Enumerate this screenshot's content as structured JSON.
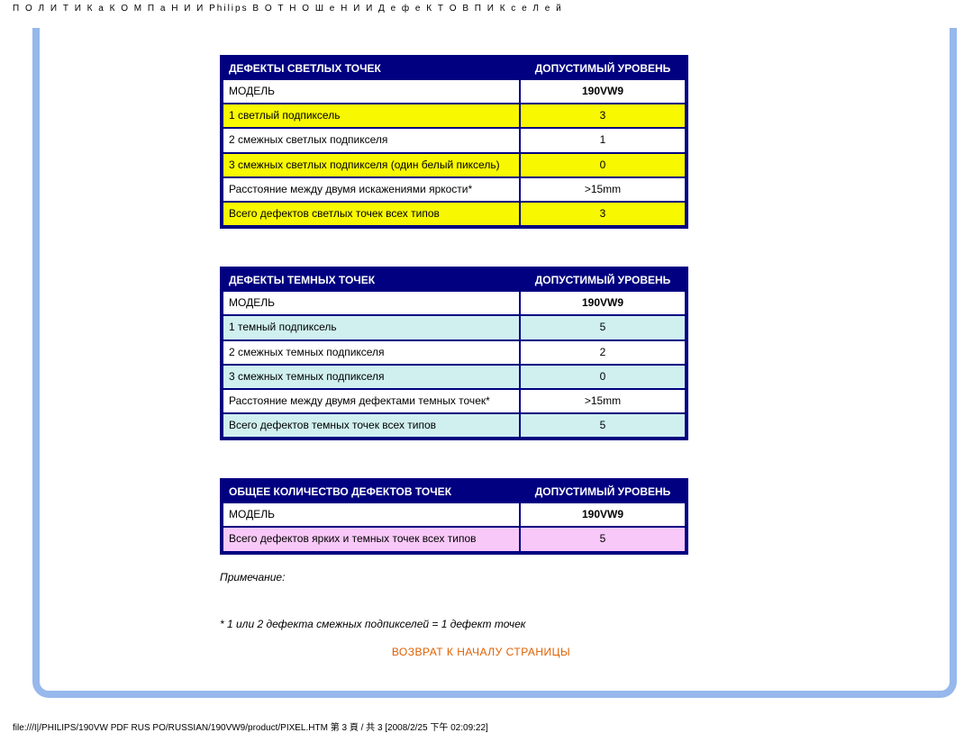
{
  "header_text": "П О Л И Т И К а   К О М П а Н И И  Philips  В  О Т Н О Ш е Н И И  Д е ф е К Т О В  П И К с е Л е й",
  "table1": {
    "h1": "ДЕФЕКТЫ СВЕТЛЫХ ТОЧЕК",
    "h2": "ДОПУСТИМЫЙ УРОВЕНЬ",
    "rows": [
      {
        "c1": "МОДЕЛЬ",
        "c2": "190VW9"
      },
      {
        "c1": "1 светлый подпиксель",
        "c2": "3"
      },
      {
        "c1": "2 смежных светлых подпикселя",
        "c2": "1"
      },
      {
        "c1": "3 смежных светлых подпикселя (один белый пиксель)",
        "c2": "0"
      },
      {
        "c1": "Расстояние между двумя искажениями яркости*",
        "c2": ">15mm"
      },
      {
        "c1": "Всего дефектов светлых точек всех типов",
        "c2": "3"
      }
    ]
  },
  "table2": {
    "h1": "ДЕФЕКТЫ ТЕМНЫХ ТОЧЕК",
    "h2": "ДОПУСТИМЫЙ УРОВЕНЬ",
    "rows": [
      {
        "c1": "МОДЕЛЬ",
        "c2": "190VW9"
      },
      {
        "c1": "1 темный подпиксель",
        "c2": "5"
      },
      {
        "c1": "2 смежных темных подпикселя",
        "c2": "2"
      },
      {
        "c1": "3 смежных темных подпикселя",
        "c2": "0"
      },
      {
        "c1": "Расстояние между двумя дефектами темных точек*",
        "c2": ">15mm"
      },
      {
        "c1": "Всего дефектов темных точек всех типов",
        "c2": "5"
      }
    ]
  },
  "table3": {
    "h1": "ОБЩЕЕ КОЛИЧЕСТВО ДЕФЕКТОВ ТОЧЕК",
    "h2": "ДОПУСТИМЫЙ УРОВЕНЬ",
    "rows": [
      {
        "c1": "МОДЕЛЬ",
        "c2": "190VW9"
      },
      {
        "c1": "Всего дефектов ярких и темных точек всех типов",
        "c2": "5"
      }
    ]
  },
  "notes_line1": "Примечание:",
  "notes_line2": "* 1 или 2 дефекта смежных подпикселей = 1 дефект точек",
  "back_link": "ВОЗВРАТ К НАЧАЛУ СТРАНИЦЫ",
  "footer_path": "file:///I|/PHILIPS/190VW PDF RUS PO/RUSSIAN/190VW9/product/PIXEL.HTM 第 3 頁 / 共 3  [2008/2/25 下午 02:09:22]"
}
